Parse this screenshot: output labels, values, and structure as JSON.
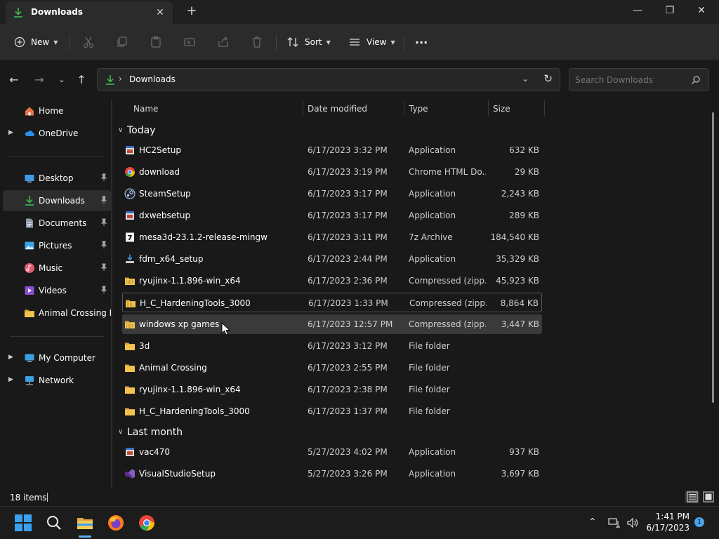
{
  "window": {
    "tab_title": "Downloads",
    "new_tab": "+",
    "minimize": "—",
    "maximize": "❐",
    "close": "✕"
  },
  "commandbar": {
    "new_label": "New",
    "sort_label": "Sort",
    "view_label": "View",
    "more_label": "···"
  },
  "address": {
    "path": "Downloads",
    "separator": "›",
    "search_placeholder": "Search Downloads"
  },
  "sidebar": {
    "items": [
      {
        "label": "Home",
        "icon": "home-icon"
      },
      {
        "label": "OneDrive",
        "icon": "cloud-icon"
      },
      {
        "label": "Desktop",
        "icon": "desktop-icon"
      },
      {
        "label": "Downloads",
        "icon": "download-icon"
      },
      {
        "label": "Documents",
        "icon": "document-icon"
      },
      {
        "label": "Pictures",
        "icon": "picture-icon"
      },
      {
        "label": "Music",
        "icon": "music-icon"
      },
      {
        "label": "Videos",
        "icon": "video-icon"
      },
      {
        "label": "Animal Crossing New Horizons",
        "icon": "folder-icon"
      },
      {
        "label": "My Computer",
        "icon": "computer-icon"
      },
      {
        "label": "Network",
        "icon": "network-icon"
      }
    ]
  },
  "columns": {
    "name": "Name",
    "date": "Date modified",
    "type": "Type",
    "size": "Size"
  },
  "groups": {
    "today": "Today",
    "last_month": "Last month"
  },
  "files": [
    {
      "name": "HC2Setup",
      "date": "6/17/2023 3:32 PM",
      "type": "Application",
      "size": "632 KB",
      "icon": "installer-icon"
    },
    {
      "name": "download",
      "date": "6/17/2023 3:19 PM",
      "type": "Chrome HTML Do...",
      "size": "29 KB",
      "icon": "chrome-icon"
    },
    {
      "name": "SteamSetup",
      "date": "6/17/2023 3:17 PM",
      "type": "Application",
      "size": "2,243 KB",
      "icon": "steam-icon"
    },
    {
      "name": "dxwebsetup",
      "date": "6/17/2023 3:17 PM",
      "type": "Application",
      "size": "289 KB",
      "icon": "installer-icon"
    },
    {
      "name": "mesa3d-23.1.2-release-mingw",
      "date": "6/17/2023 3:11 PM",
      "type": "7z Archive",
      "size": "184,540 KB",
      "icon": "7z-icon"
    },
    {
      "name": "fdm_x64_setup",
      "date": "6/17/2023 2:44 PM",
      "type": "Application",
      "size": "35,329 KB",
      "icon": "fdm-icon"
    },
    {
      "name": "ryujinx-1.1.896-win_x64",
      "date": "6/17/2023 2:36 PM",
      "type": "Compressed (zipp...",
      "size": "45,923 KB",
      "icon": "zip-folder-icon"
    },
    {
      "name": "H_C_HardeningTools_3000",
      "date": "6/17/2023 1:33 PM",
      "type": "Compressed (zipp...",
      "size": "8,864 KB",
      "icon": "zip-folder-icon"
    },
    {
      "name": "windows xp games",
      "date": "6/17/2023 12:57 PM",
      "type": "Compressed (zipp...",
      "size": "3,447 KB",
      "icon": "zip-folder-icon"
    },
    {
      "name": "3d",
      "date": "6/17/2023 3:12 PM",
      "type": "File folder",
      "size": "",
      "icon": "folder-icon"
    },
    {
      "name": "Animal Crossing",
      "date": "6/17/2023 2:55 PM",
      "type": "File folder",
      "size": "",
      "icon": "folder-icon"
    },
    {
      "name": "ryujinx-1.1.896-win_x64",
      "date": "6/17/2023 2:38 PM",
      "type": "File folder",
      "size": "",
      "icon": "folder-icon"
    },
    {
      "name": "H_C_HardeningTools_3000",
      "date": "6/17/2023 1:37 PM",
      "type": "File folder",
      "size": "",
      "icon": "folder-icon"
    },
    {
      "name": "vac470",
      "date": "5/27/2023 4:02 PM",
      "type": "Application",
      "size": "937 KB",
      "icon": "installer-icon"
    },
    {
      "name": "VisualStudioSetup",
      "date": "5/27/2023 3:26 PM",
      "type": "Application",
      "size": "3,697 KB",
      "icon": "visual-studio-icon"
    }
  ],
  "status": {
    "count": "18 items"
  },
  "taskbar": {
    "time": "1:41 PM",
    "date": "6/17/2023",
    "notifications": "1"
  },
  "colors": {
    "accent": "#4aa3e8",
    "folder": "#f2c24e",
    "download_green": "#3fb950"
  }
}
